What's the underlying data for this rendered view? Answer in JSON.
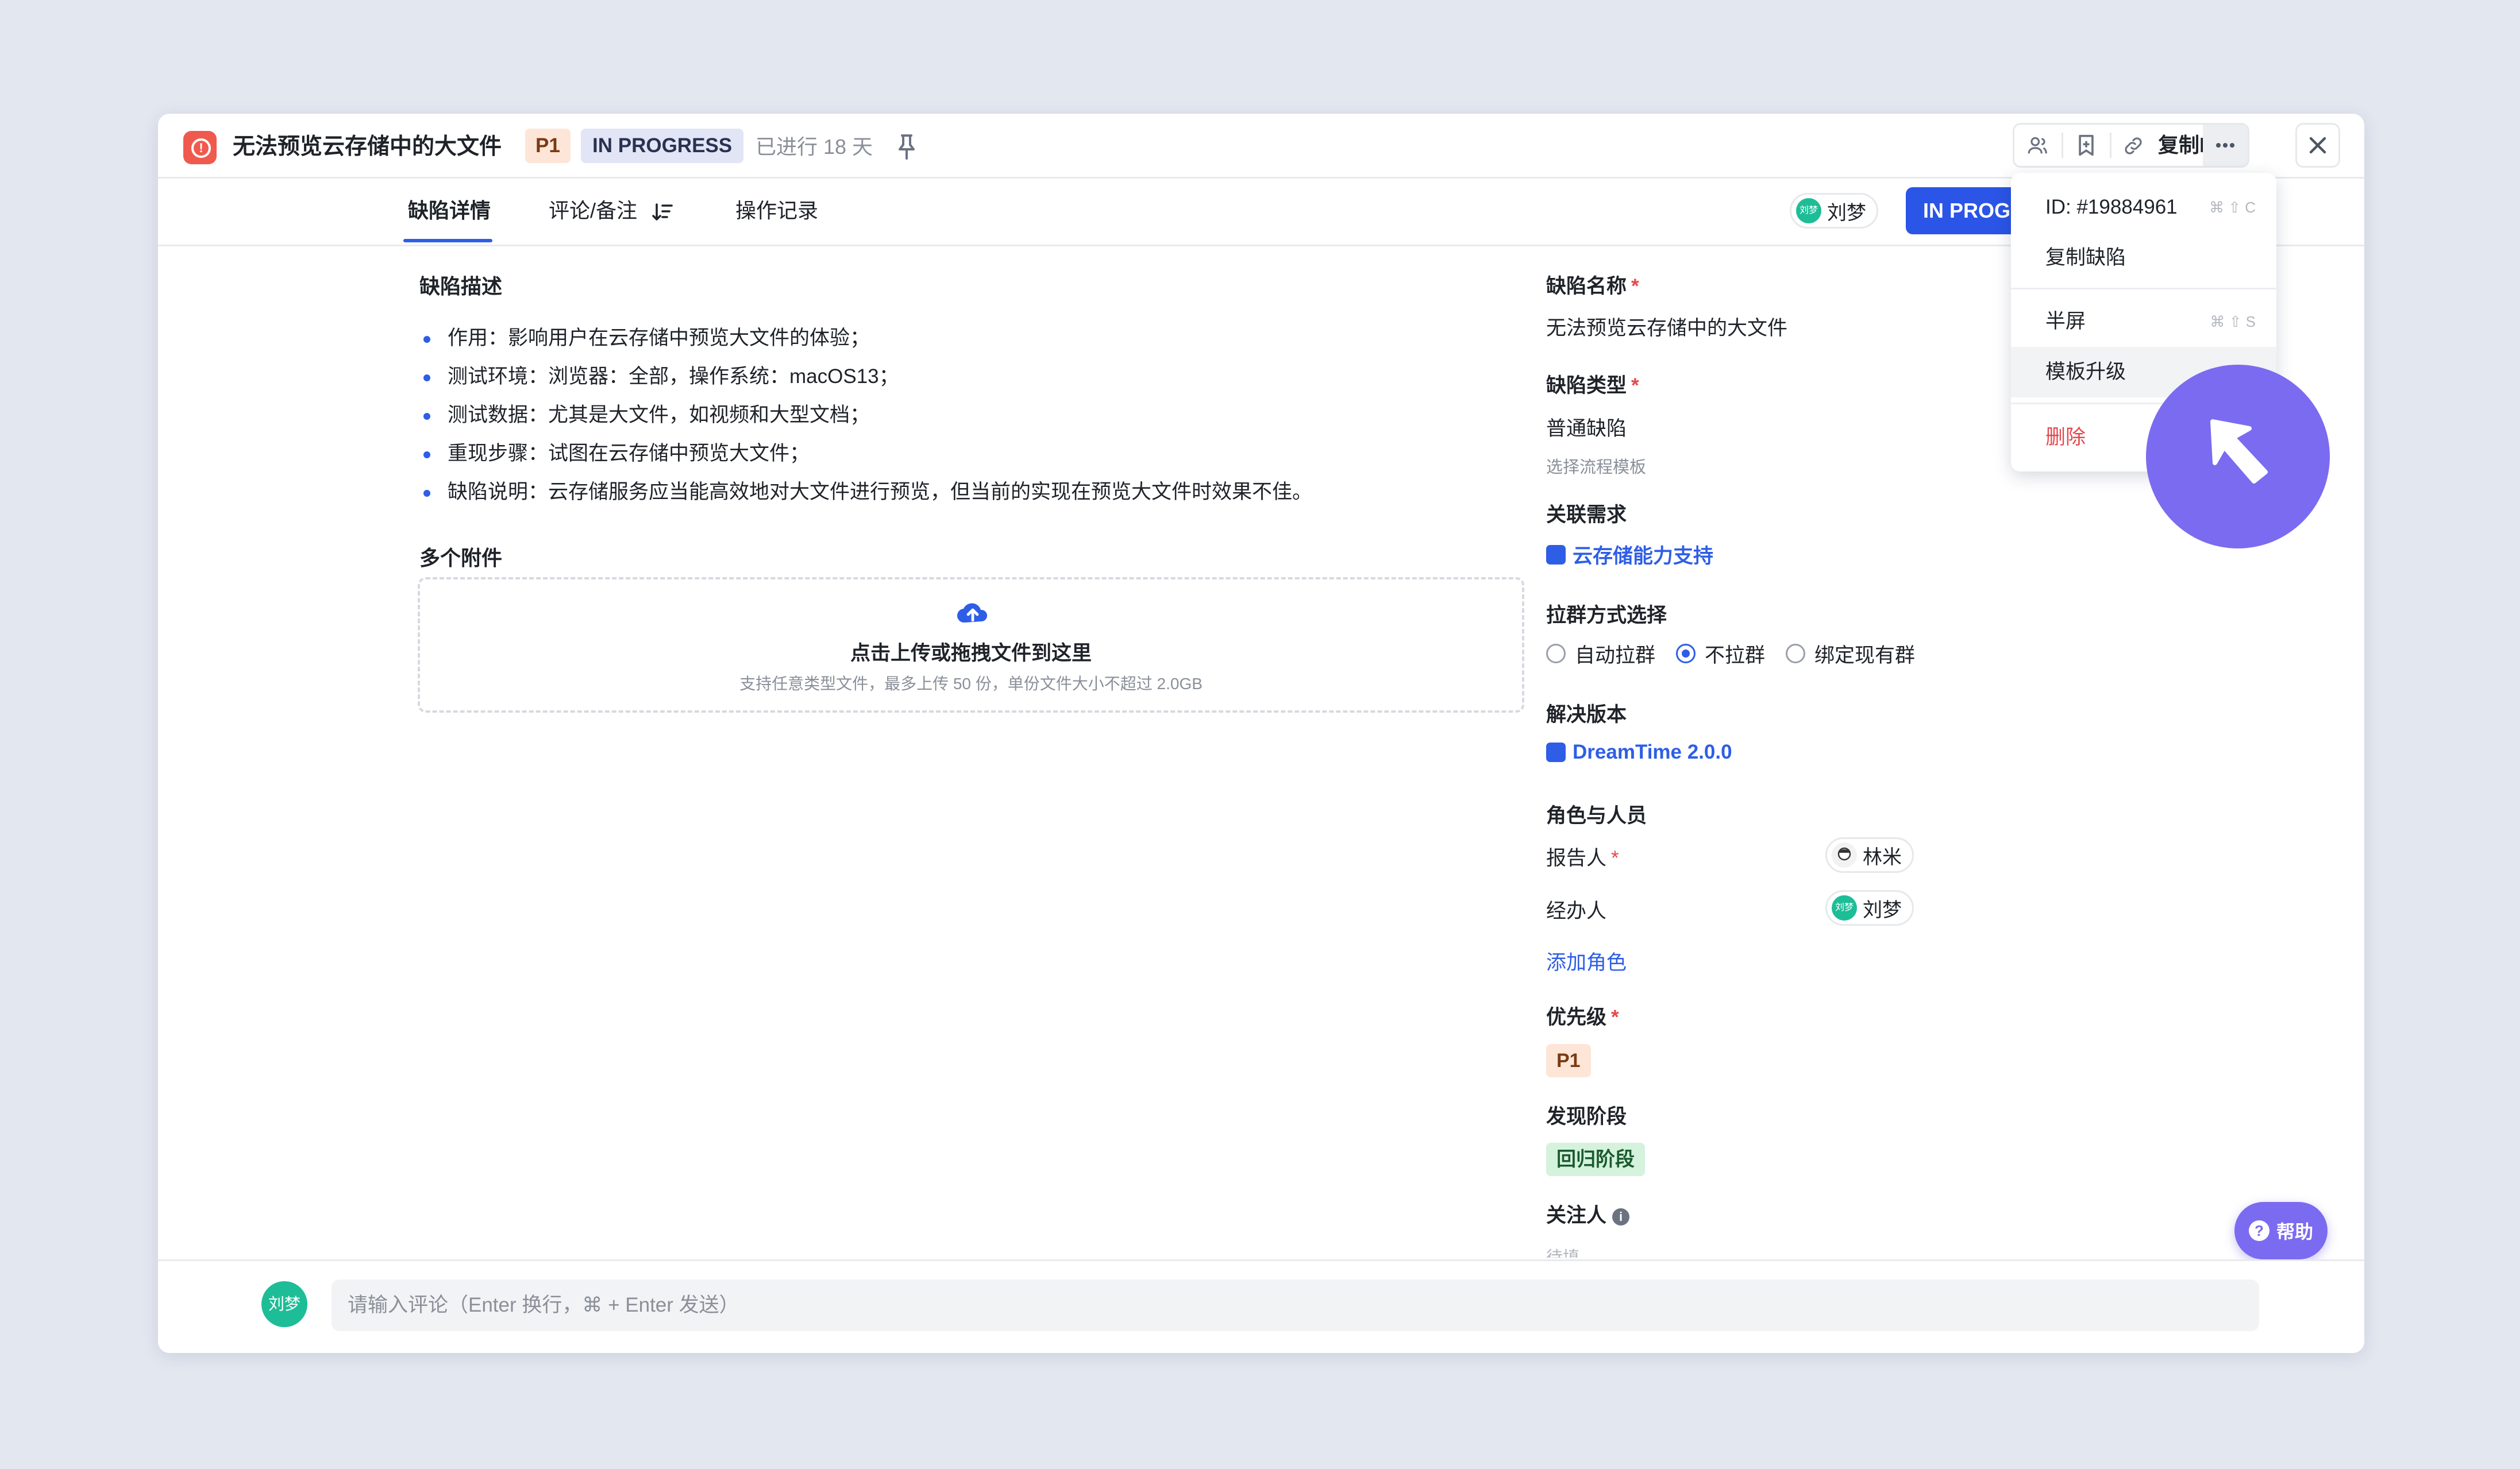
{
  "header": {
    "title": "无法预览云存储中的大文件",
    "priority": "P1",
    "status": "IN PROGRESS",
    "elapsed": "已进行 18 天",
    "copy_id_label": "复制ID"
  },
  "tabs": [
    {
      "label": "缺陷详情"
    },
    {
      "label": "评论/备注"
    },
    {
      "label": "操作记录"
    }
  ],
  "tab_bar": {
    "assignee_avatar": "刘梦",
    "assignee": "刘梦",
    "status_button": "IN PROG"
  },
  "description": {
    "title": "缺陷描述",
    "items": [
      "作用：影响用户在云存储中预览大文件的体验；",
      "测试环境：浏览器：全部，操作系统：macOS13；",
      "测试数据：尤其是大文件，如视频和大型文档；",
      "重现步骤：试图在云存储中预览大文件；",
      "缺陷说明：云存储服务应当能高效地对大文件进行预览，但当前的实现在预览大文件时效果不佳。"
    ]
  },
  "attachments": {
    "title": "多个附件",
    "upload_main": "点击上传或拖拽文件到这里",
    "upload_sub": "支持任意类型文件，最多上传 50 份，单份文件大小不超过 2.0GB"
  },
  "fields": {
    "name_label": "缺陷名称",
    "name_value": "无法预览云存储中的大文件",
    "type_label": "缺陷类型",
    "type_value": "普通缺陷",
    "type_hint": "选择流程模板",
    "req_label": "关联需求",
    "req_value": "云存储能力支持",
    "group_label": "拉群方式选择",
    "group_options": [
      "自动拉群",
      "不拉群",
      "绑定现有群"
    ],
    "version_label": "解决版本",
    "version_value": "DreamTime 2.0.0",
    "roles_label": "角色与人员",
    "reporter_label": "报告人",
    "reporter": "林米",
    "handler_label": "经办人",
    "handler_avatar": "刘梦",
    "handler": "刘梦",
    "add_role": "添加角色",
    "priority_label": "优先级",
    "priority_value": "P1",
    "stage_label": "发现阶段",
    "stage_value": "回归阶段",
    "watchers_label": "关注人",
    "watchers_value": "待填"
  },
  "required_mark": "*",
  "help": {
    "label": "帮助"
  },
  "comment": {
    "avatar": "刘梦",
    "placeholder": "请输入评论（Enter 换行，⌘ + Enter 发送）"
  },
  "menu": {
    "items": [
      {
        "label": "ID: #19884961",
        "shortcut": "⌘ ⇧ C"
      },
      {
        "label": "复制缺陷",
        "shortcut": ""
      },
      {
        "label": "半屏",
        "shortcut": "⌘ ⇧ S"
      },
      {
        "label": "模板升级",
        "shortcut": ""
      },
      {
        "label": "删除",
        "shortcut": ""
      }
    ]
  },
  "colors": {
    "accent": "#2e5ee6",
    "danger": "#e5484d",
    "cursor": "#7b6bf0",
    "bug_icon": "#f05a4e"
  },
  "icons": [
    "bug-icon",
    "pin-icon",
    "person-icon",
    "bookmark-icon",
    "link-icon",
    "more-icon",
    "close-icon",
    "sort-icon",
    "upload-cloud-icon",
    "info-icon",
    "help-icon",
    "cursor-arrow-icon"
  ]
}
